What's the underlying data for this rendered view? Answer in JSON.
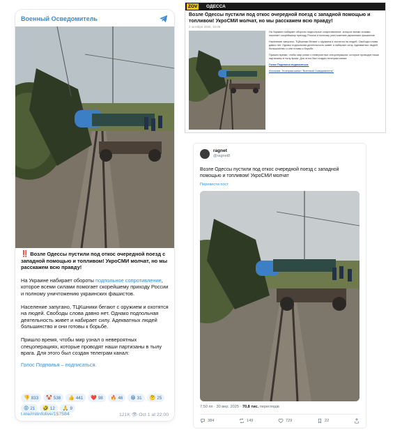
{
  "telegram": {
    "channel_name": "Военный Осведомитель",
    "headline_mark": "‼️",
    "headline": "Возле Одессы пустили под откос очередной поезд с западной помощью и топливом! УкроСМИ молчат, но мы расскажем всю правду!",
    "p1_before": "На Украине набирает обороты ",
    "p1_link": "подпольное сопротивление",
    "p1_after": ", которое всеми силами помогает скорейшему приходу России и полному уничтожению украинских фашистов.",
    "p2": "Население запугано, ТЦКшники бегают с оружием и охотятся на людей. Свободы слова давно нет. Однако подпольная деятельность живет и набирает силу. Адекватных людей большинство и они готовы к борьбе.",
    "p3": "Пришло время, чтобы мир узнал о невероятных спецоперациях, которые проводят наши партизаны в тылу врага. Для этого был создан телеграм канал:",
    "subscribe": "Голос Подполья – подписаться.",
    "reactions": [
      {
        "emoji": "👎",
        "count": "833"
      },
      {
        "emoji": "🤡",
        "count": "538"
      },
      {
        "emoji": "👍",
        "count": "441"
      },
      {
        "emoji": "❤️",
        "count": "98"
      },
      {
        "emoji": "🔥",
        "count": "46"
      },
      {
        "emoji": "😁",
        "count": "31"
      },
      {
        "emoji": "🤔",
        "count": "25"
      },
      {
        "emoji": "😡",
        "count": "21"
      },
      {
        "emoji": "🤣",
        "count": "12"
      },
      {
        "emoji": "🙏",
        "count": "9"
      }
    ],
    "post_url": "t.me/milinfolive/157584",
    "views": "121K",
    "date": "Oct 1 at 22:00"
  },
  "news": {
    "logo": "ZOV",
    "city": "ОДЕССА",
    "title": "Возле Одессы пустили под откос очередной поезд с западной помощью и топливом! УкроСМИ молчат, но мы расскажем всю правду!",
    "date": "2 октября 2025, 15:09",
    "b1": "На Украине набирает обороты подпольное сопротивление, которое всеми силами помогает скорейшему приходу России и полному уничтожению украинских фашистов.",
    "b2": "Население запугано, ТЦКшники бегают с оружием и охотятся на людей. Свободы слова давно нет. Однако подпольная деятельность живет и набирает силу. Адекватных людей большинство и они готовы к борьбе.",
    "b3": "Пришло время, чтобы мир узнал о невероятных спецоперациях, которые проводят наши партизаны в тылу врага. Для этого был создан телеграм канал:",
    "b4": "Голос Подполья подписаться.",
    "b5": "Источник: Телеграм-канал \"Военный Осведомитель\""
  },
  "twitter": {
    "name": "ragnet",
    "handle": "@ragnet8",
    "text": "Возле Одессы пустили под откос очередной поезд с западной помощью и топливом! УкроСМИ молчат",
    "translate": "Перевести пост",
    "time": "7:50 пп · 30 вер. 2025 · ",
    "views": "70,8 тис.",
    "views_label": " переглядів",
    "replies": "384",
    "reposts": "149",
    "likes": "729",
    "bookmarks": "22"
  },
  "colors": {
    "telegram_link": "#3a8ad4",
    "news_logo": "#f5c400",
    "twitter_blue": "#1d9bf0"
  }
}
